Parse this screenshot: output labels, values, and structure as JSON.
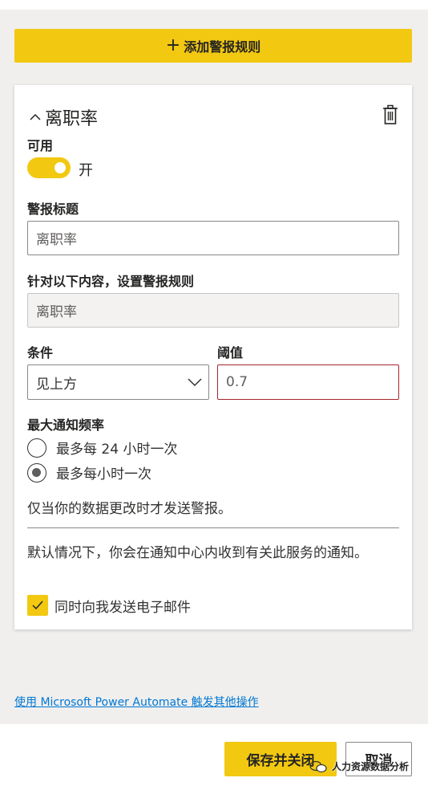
{
  "add_alert_button": {
    "icon": "plus-icon",
    "label": "添加警报规则"
  },
  "rule": {
    "title": "离职率",
    "enabled_label": "可用",
    "toggle_state": "开",
    "alert_title_label": "警报标题",
    "alert_title_value": "离职率",
    "target_label": "针对以下内容，设置警报规则",
    "target_value": "离职率",
    "condition_label": "条件",
    "condition_value": "见上方",
    "threshold_label": "阈值",
    "threshold_value": "0.7",
    "frequency_label": "最大通知频率",
    "frequency_options": [
      {
        "label": "最多每 24 小时一次",
        "checked": false
      },
      {
        "label": "最多每小时一次",
        "checked": true
      }
    ],
    "change_note": "仅当你的数据更改时才发送警报。",
    "default_note": "默认情况下，你会在通知中心内收到有关此服务的通知。",
    "email_label": "同时向我发送电子邮件",
    "email_checked": true
  },
  "power_automate_link": "使用 Microsoft Power Automate 触发其他操作",
  "footer": {
    "save_label": "保存并关闭",
    "cancel_label": "取消"
  },
  "watermark": "人力资源数据分析",
  "colors": {
    "accent": "#f2c811",
    "link": "#0078d4",
    "error_border": "#a4262c"
  }
}
